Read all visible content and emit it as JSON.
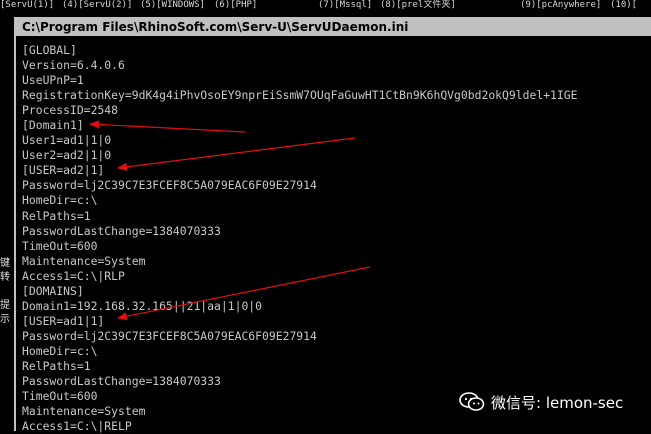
{
  "tabs": [
    "[ServU(1)]",
    "(4)[ServU(2)]",
    "(5)[WINDOWS]",
    "(6)[PHP]",
    "(7)[Mssql]",
    "(8)[prel文件夹]",
    "(9)[pcAnywhere]",
    "(10)["
  ],
  "side_text": [
    "键",
    "转",
    "提",
    "示"
  ],
  "window": {
    "title": "C:\\Program Files\\RhinoSoft.com\\Serv-U\\ServUDaemon.ini"
  },
  "lines": [
    "[GLOBAL]",
    "Version=6.4.0.6",
    "UseUPnP=1",
    "RegistrationKey=9dK4g4iPhvOsoEY9nprEiSsmW7OUqFaGuwHT1CtBn9K6hQVg0bd2okQ9ldel+1IGE",
    "ProcessID=2548",
    "[Domain1]",
    "User1=ad1|1|0",
    "User2=ad2|1|0",
    "[USER=ad2|1]",
    "Password=lj2C39C7E3FCEF8C5A079EAC6F09E27914",
    "HomeDir=c:\\",
    "RelPaths=1",
    "PasswordLastChange=1384070333",
    "TimeOut=600",
    "Maintenance=System",
    "Access1=C:\\|RLP",
    "[DOMAINS]",
    "Domain1=192.168.32.165||21|aa|1|0|0",
    "[USER=ad1|1]",
    "Password=lj2C39C7E3FCEF8C5A079EAC6F09E27914",
    "HomeDir=c:\\",
    "RelPaths=1",
    "PasswordLastChange=1384070333",
    "TimeOut=600",
    "Maintenance=System",
    "Access1=C:\\|RELP"
  ],
  "watermark": {
    "text": "微信号: lemon-sec",
    "icon": "wechat-icon"
  },
  "colors": {
    "background": "#000000",
    "console_text": "#c8c8c8",
    "titlebar": "#c0c0c0",
    "arrow": "#e01010"
  }
}
